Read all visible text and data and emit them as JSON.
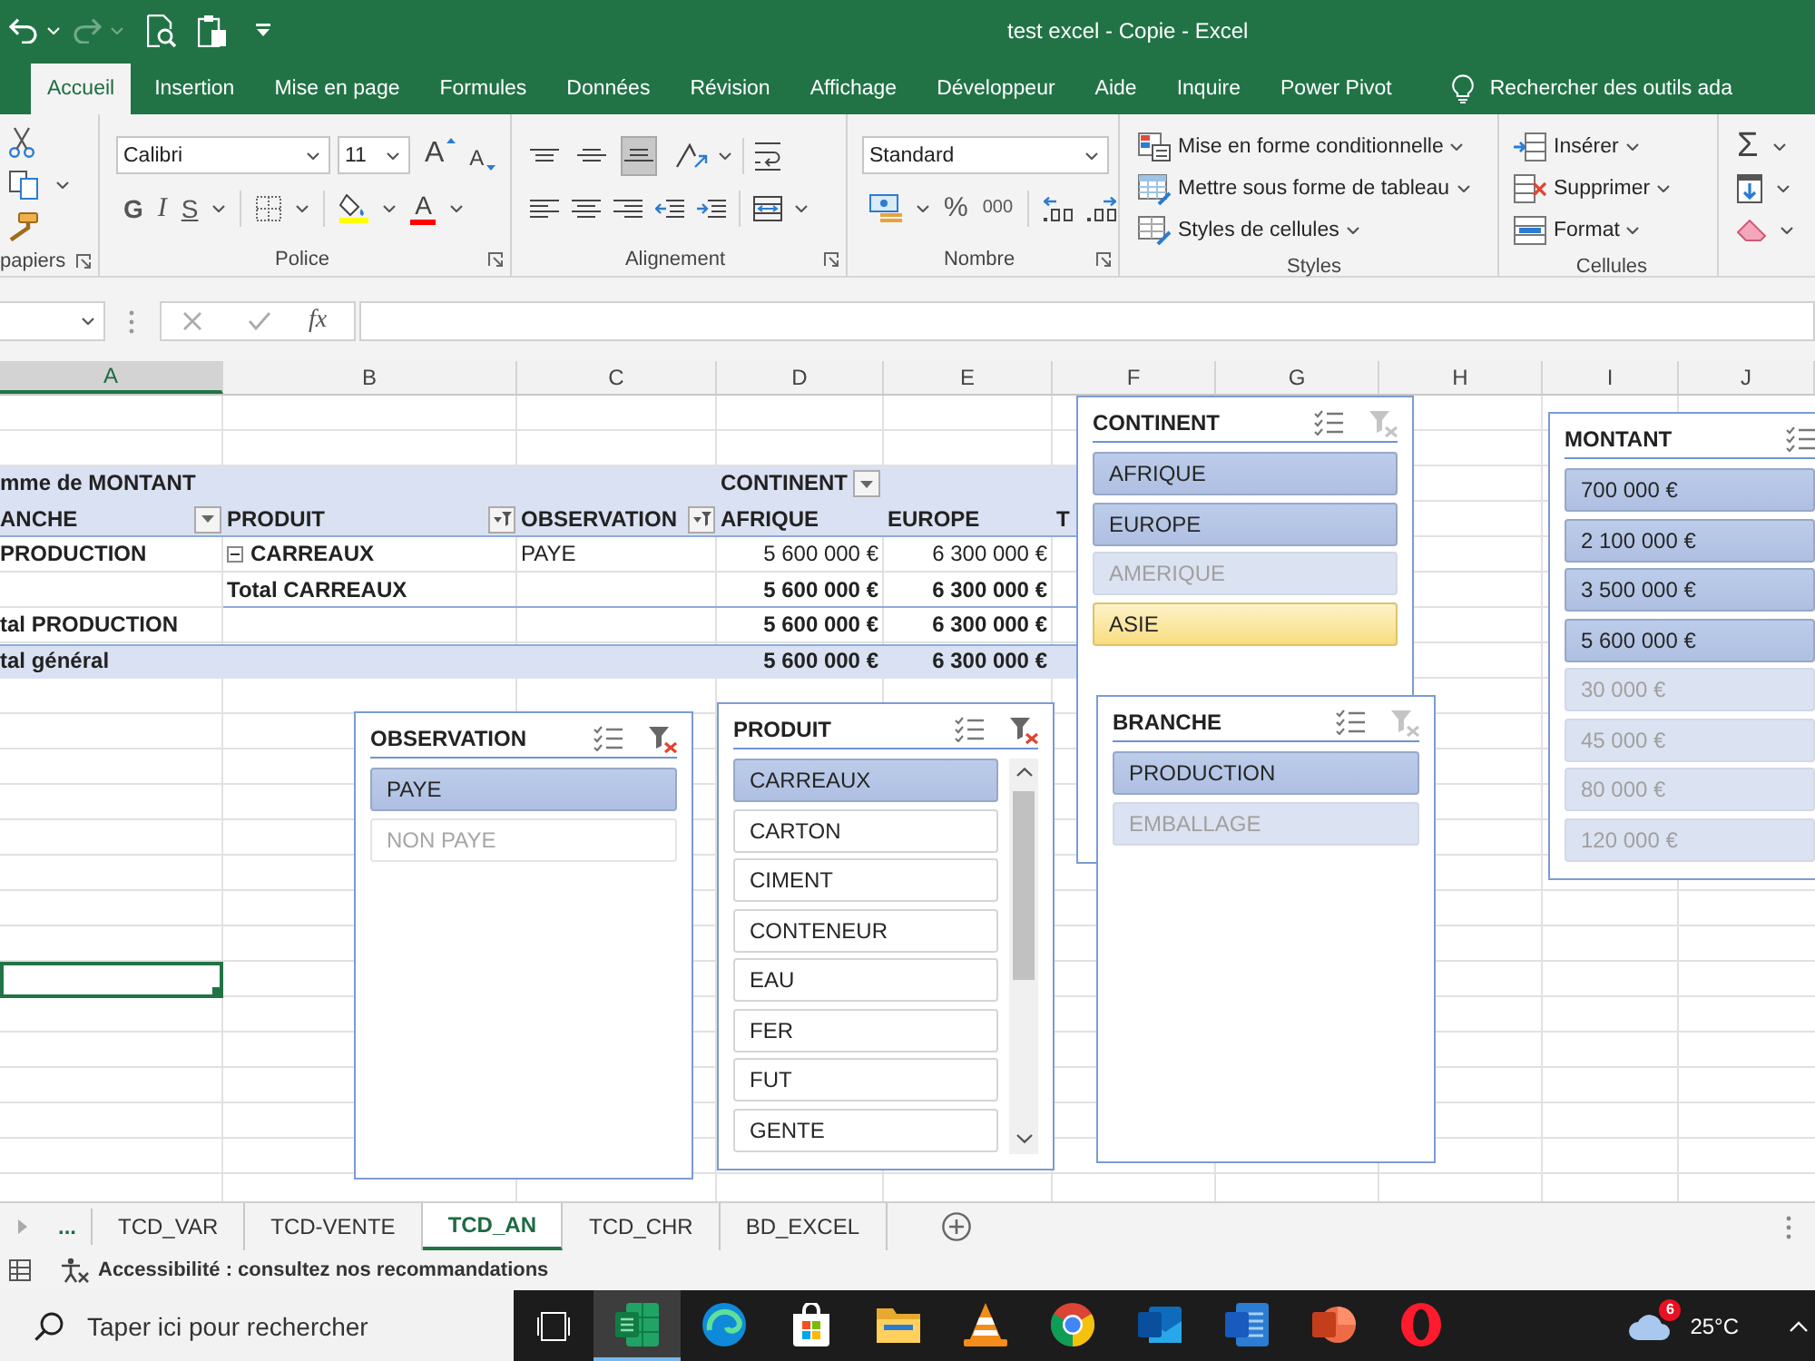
{
  "window": {
    "title": "test excel - Copie - Excel"
  },
  "quick_access": [
    {
      "kind": "undo",
      "disabled": false
    },
    {
      "kind": "redo",
      "disabled": true
    },
    {
      "kind": "print_preview",
      "disabled": false
    },
    {
      "kind": "paste",
      "disabled": false
    },
    {
      "kind": "customize",
      "disabled": false
    }
  ],
  "ribbon_tabs": [
    {
      "label": "Accueil",
      "selected": true
    },
    {
      "label": "Insertion",
      "selected": false
    },
    {
      "label": "Mise en page",
      "selected": false
    },
    {
      "label": "Formules",
      "selected": false
    },
    {
      "label": "Données",
      "selected": false
    },
    {
      "label": "Révision",
      "selected": false
    },
    {
      "label": "Affichage",
      "selected": false
    },
    {
      "label": "Développeur",
      "selected": false
    },
    {
      "label": "Aide",
      "selected": false
    },
    {
      "label": "Inquire",
      "selected": false
    },
    {
      "label": "Power Pivot",
      "selected": false
    }
  ],
  "search_hint": {
    "label": "Rechercher des outils ada"
  },
  "ribbon": {
    "groups": [
      {
        "kind": "clipboard",
        "label": "papiers",
        "launcher": true
      },
      {
        "kind": "font",
        "label": "Police",
        "launcher": true,
        "font_name": "Calibri",
        "font_size": "11",
        "grow_font": "A",
        "shrink_font": "A",
        "bold": "G",
        "italic": "I",
        "underline": "S",
        "font_color": "A"
      },
      {
        "kind": "alignment",
        "label": "Alignement",
        "launcher": true,
        "vertical": [
          {
            "selected": false
          },
          {
            "selected": false
          },
          {
            "selected": true
          }
        ]
      },
      {
        "kind": "number",
        "label": "Nombre",
        "launcher": true,
        "format": "Standard",
        "percent": "%",
        "thousands": "000"
      },
      {
        "kind": "styles",
        "label": "Styles",
        "commands": [
          "Mise en forme conditionnelle",
          "Mettre sous forme de tableau",
          "Styles de cellules"
        ]
      },
      {
        "kind": "cells",
        "label": "Cellules",
        "commands": [
          "Insérer",
          "Supprimer",
          "Format"
        ]
      },
      {
        "kind": "editing",
        "sum": "Σ"
      }
    ]
  },
  "formula_bar": {
    "function_button": "fx"
  },
  "columns": [
    {
      "label": "A",
      "selected": true
    },
    {
      "label": "B",
      "selected": false
    },
    {
      "label": "C",
      "selected": false
    },
    {
      "label": "D",
      "selected": false
    },
    {
      "label": "E",
      "selected": false
    },
    {
      "label": "F",
      "selected": false
    },
    {
      "label": "G",
      "selected": false
    },
    {
      "label": "H",
      "selected": false
    },
    {
      "label": "I",
      "selected": false
    },
    {
      "label": "J",
      "selected": false
    }
  ],
  "pivot_table": {
    "value_field": "mme de MONTANT",
    "column_field": {
      "label": "CONTINENT",
      "filtered": false
    },
    "row_headers": [
      {
        "label": "ANCHE",
        "filtered": false
      },
      {
        "label": "PRODUIT",
        "filtered": true
      },
      {
        "label": "OBSERVATION",
        "filtered": true
      }
    ],
    "column_items": [
      "AFRIQUE",
      "EUROPE",
      "T"
    ],
    "rows": [
      {
        "kind": "detail",
        "labels": [
          "PRODUCTION",
          "CARREAUX",
          "PAYE"
        ],
        "expanded": true,
        "values": [
          "5 600 000 €",
          "6 300 000 €"
        ]
      },
      {
        "kind": "product_total",
        "label": "Total CARREAUX",
        "values": [
          "5 600 000 €",
          "6 300 000 €"
        ]
      },
      {
        "kind": "branch_total",
        "label": "tal PRODUCTION",
        "values": [
          "5 600 000 €",
          "6 300 000 €"
        ]
      },
      {
        "kind": "grand_total",
        "label": "tal général",
        "values": [
          "5 600 000 €",
          "6 300 000 €"
        ]
      }
    ]
  },
  "slicers": [
    {
      "title": "OBSERVATION",
      "filtered": true,
      "items": [
        {
          "label": "PAYE",
          "selected": true,
          "has_data": true,
          "hovered": false
        },
        {
          "label": "NON PAYE",
          "selected": false,
          "has_data": false,
          "hovered": false
        }
      ]
    },
    {
      "title": "PRODUIT",
      "filtered": true,
      "scrollable": true,
      "items": [
        {
          "label": "CARREAUX",
          "selected": true,
          "has_data": true,
          "hovered": false
        },
        {
          "label": "CARTON",
          "selected": false,
          "has_data": true,
          "hovered": false
        },
        {
          "label": "CIMENT",
          "selected": false,
          "has_data": true,
          "hovered": false
        },
        {
          "label": "CONTENEUR",
          "selected": false,
          "has_data": true,
          "hovered": false
        },
        {
          "label": "EAU",
          "selected": false,
          "has_data": true,
          "hovered": false
        },
        {
          "label": "FER",
          "selected": false,
          "has_data": true,
          "hovered": false
        },
        {
          "label": "FUT",
          "selected": false,
          "has_data": true,
          "hovered": false
        },
        {
          "label": "GENTE",
          "selected": false,
          "has_data": true,
          "hovered": false
        }
      ]
    },
    {
      "title": "CONTINENT",
      "filtered": false,
      "items": [
        {
          "label": "AFRIQUE",
          "selected": true,
          "has_data": true,
          "hovered": false
        },
        {
          "label": "EUROPE",
          "selected": true,
          "has_data": true,
          "hovered": false
        },
        {
          "label": "AMERIQUE",
          "selected": true,
          "has_data": false,
          "hovered": false
        },
        {
          "label": "ASIE",
          "selected": false,
          "has_data": true,
          "hovered": true
        }
      ]
    },
    {
      "title": "BRANCHE",
      "filtered": false,
      "items": [
        {
          "label": "PRODUCTION",
          "selected": true,
          "has_data": true,
          "hovered": false
        },
        {
          "label": "EMBALLAGE",
          "selected": true,
          "has_data": false,
          "hovered": false
        }
      ]
    },
    {
      "title": "MONTANT",
      "items": [
        {
          "label": "700 000 €",
          "selected": true,
          "has_data": true,
          "hovered": false
        },
        {
          "label": "2 100 000 €",
          "selected": true,
          "has_data": true,
          "hovered": false
        },
        {
          "label": "3 500 000 €",
          "selected": true,
          "has_data": true,
          "hovered": false
        },
        {
          "label": "5 600 000 €",
          "selected": true,
          "has_data": true,
          "hovered": false
        },
        {
          "label": "30 000 €",
          "selected": true,
          "has_data": false,
          "hovered": false
        },
        {
          "label": "45 000 €",
          "selected": true,
          "has_data": false,
          "hovered": false
        },
        {
          "label": "80 000 €",
          "selected": true,
          "has_data": false,
          "hovered": false
        },
        {
          "label": "120 000 €",
          "selected": true,
          "has_data": false,
          "hovered": false
        }
      ]
    }
  ],
  "sheet_tabs": {
    "more": "...",
    "tabs": [
      {
        "label": "TCD_VAR",
        "selected": false
      },
      {
        "label": "TCD-VENTE",
        "selected": false
      },
      {
        "label": "TCD_AN",
        "selected": true
      },
      {
        "label": "TCD_CHR",
        "selected": false
      },
      {
        "label": "BD_EXCEL",
        "selected": false
      }
    ]
  },
  "status_bar": {
    "accessibility": "Accessibilité : consultez nos recommandations"
  },
  "taskbar": {
    "search": {
      "placeholder": "Taper ici pour rechercher"
    },
    "apps": [
      {
        "kind": "sheets",
        "active": true
      },
      {
        "kind": "wave",
        "active": false
      },
      {
        "kind": "store",
        "active": false
      },
      {
        "kind": "folder",
        "active": false
      },
      {
        "kind": "cone",
        "active": false
      },
      {
        "kind": "ring",
        "active": false
      },
      {
        "kind": "mail",
        "active": false
      },
      {
        "kind": "doc",
        "active": false
      },
      {
        "kind": "slides",
        "active": false
      },
      {
        "kind": "oring",
        "active": false
      }
    ],
    "weather": {
      "badge": "6",
      "temperature": "25°C"
    }
  }
}
